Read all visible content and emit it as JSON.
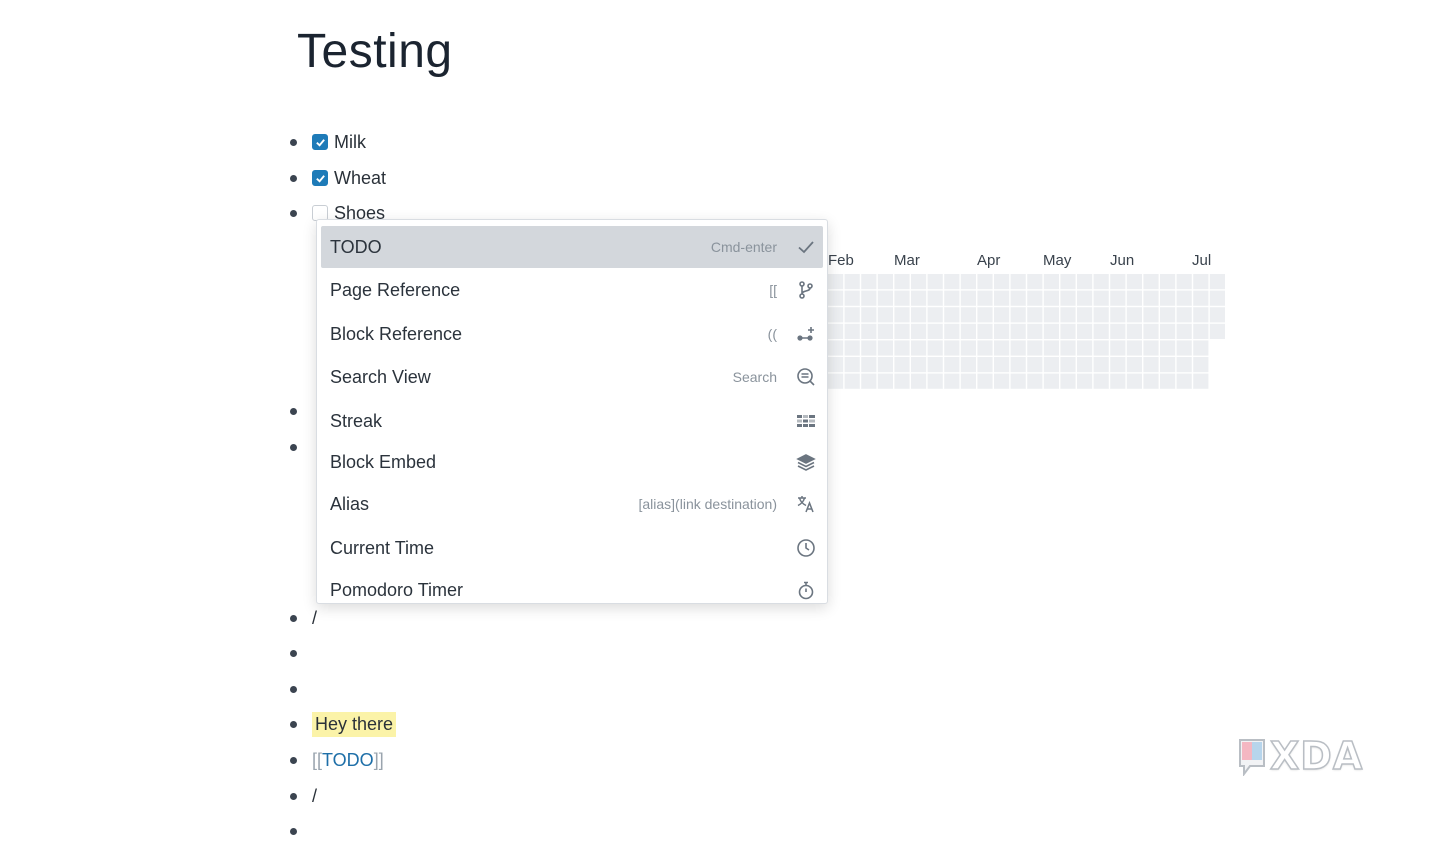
{
  "page": {
    "title": "Testing"
  },
  "blocks": {
    "milk": "Milk",
    "wheat": "Wheat",
    "shoes": "Shoes",
    "slash1": "/",
    "hey": "Hey there",
    "ref_open": "[[",
    "ref_text": "TODO",
    "ref_close": "]]",
    "slash2": "/"
  },
  "streak": {
    "months": [
      "Feb",
      "Mar",
      "Apr",
      "May",
      "Jun",
      "Jul"
    ]
  },
  "menu": {
    "items": [
      {
        "label": "TODO",
        "shortcut": "Cmd-enter",
        "icon": "check-icon"
      },
      {
        "label": "Page Reference",
        "shortcut": "[[",
        "icon": "git-branch-icon"
      },
      {
        "label": "Block Reference",
        "shortcut": "((",
        "icon": "block-ref-icon"
      },
      {
        "label": "Search View",
        "shortcut": "Search",
        "icon": "search-list-icon"
      },
      {
        "label": "Streak",
        "shortcut": "",
        "icon": "grid-streak-icon"
      },
      {
        "label": "Block Embed",
        "shortcut": "",
        "icon": "layers-plus-icon"
      },
      {
        "label": "Alias",
        "shortcut": "[alias](link destination)",
        "icon": "translate-icon"
      },
      {
        "label": "Current Time",
        "shortcut": "",
        "icon": "clock-icon"
      },
      {
        "label": "Pomodoro Timer",
        "shortcut": "",
        "icon": "stopwatch-icon"
      }
    ]
  },
  "watermark": {
    "text": "XDA"
  },
  "colors": {
    "accent": "#1e7bb8",
    "highlight": "#fbf3a8",
    "menu_active": "#d3d7dc"
  }
}
